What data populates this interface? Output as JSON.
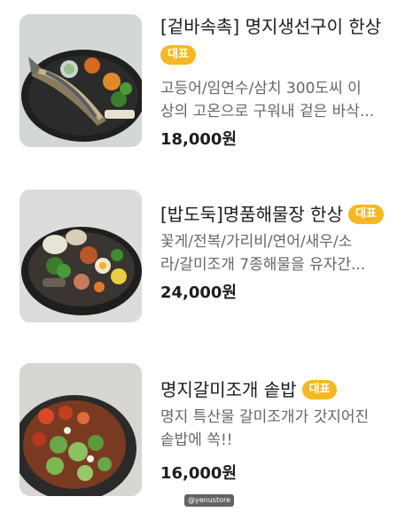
{
  "menu": {
    "items": [
      {
        "title": "[겉바속촉] 명지생선구이 한상",
        "badge": "대표",
        "description_lines": [
          "고등어/임연수/삼치 300도씨 이",
          "상의 고온으로 구워내 겉은 바삭..."
        ],
        "price": "18,000원",
        "image_icon": "grilled-fish-platter"
      },
      {
        "title": "[밥도둑]명품해물장 한상",
        "badge": "대표",
        "description_lines": [
          "꽃게/전복/가리비/연어/새우/소",
          "라/갈미조개 7종해물을 유자간..."
        ],
        "price": "24,000원",
        "image_icon": "seafood-platter"
      },
      {
        "title": "명지갈미조개 솥밥",
        "badge": "대표",
        "description_lines": [
          "명지 특산물 갈미조개가 갓지어진",
          "솥밥에 쏙!!"
        ],
        "price": "16,000원",
        "image_icon": "clam-pot-rice"
      }
    ]
  },
  "watermark": "@yenustore",
  "colors": {
    "badge": "#f5b823",
    "price": "#1c1c1c",
    "description": "#666666"
  }
}
